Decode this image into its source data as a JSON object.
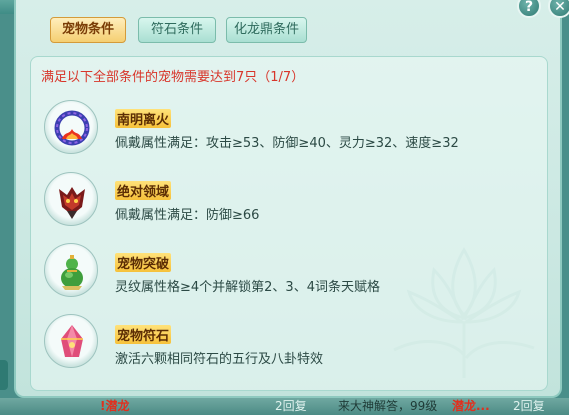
{
  "tabs": [
    {
      "label": "宠物条件",
      "active": true
    },
    {
      "label": "符石条件",
      "active": false
    },
    {
      "label": "化龙鼎条件",
      "active": false
    }
  ],
  "top_buttons": {
    "help": "?",
    "close": "✕"
  },
  "requirement": "满足以下全部条件的宠物需要达到7只（1/7）",
  "conditions": [
    {
      "title": "南明离火",
      "desc": "佩戴属性满足：攻击≥53、防御≥40、灵力≥32、速度≥32",
      "icon": "fire-ring-icon"
    },
    {
      "title": "绝对领域",
      "desc": "佩戴属性满足：防御≥66",
      "icon": "demon-mask-icon"
    },
    {
      "title": "宠物突破",
      "desc": "灵纹属性格≥4个并解锁第2、3、4词条天赋格",
      "icon": "gourd-icon"
    },
    {
      "title": "宠物符石",
      "desc": "激活六颗相同符石的五行及八卦特效",
      "icon": "rune-crystal-icon"
    }
  ],
  "bottom_bar": {
    "left_text": "!潜龙",
    "reply1": "2回复",
    "mid_text": "来大神解答，99级",
    "mid_red": "潜龙...",
    "reply2": "2回复"
  },
  "colors": {
    "requirement": "#d8352a",
    "title_bg": "#f6c13a",
    "panel_bg": "#d7eee9",
    "active_tab": "#f5cf72"
  }
}
